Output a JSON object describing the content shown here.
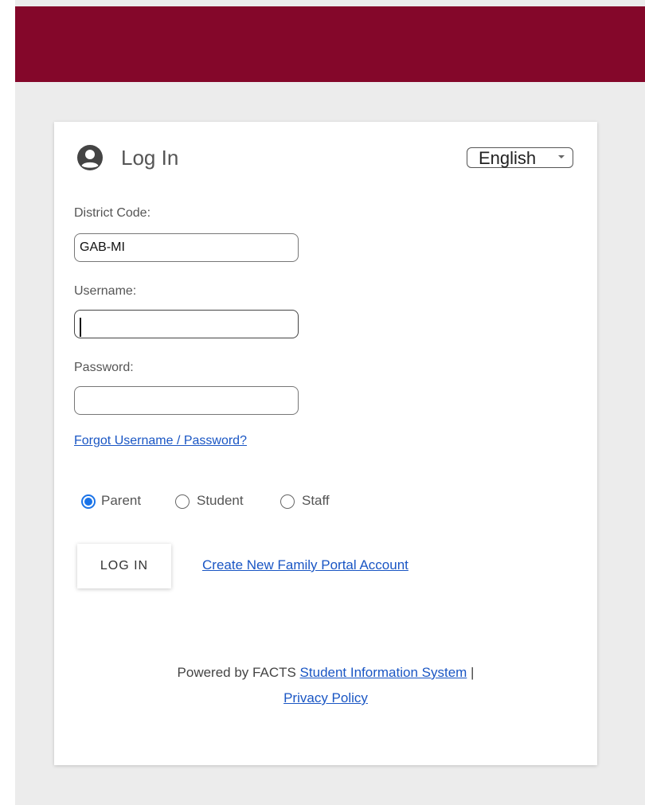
{
  "header": {
    "bar_color": "#84072a"
  },
  "login": {
    "title": "Log In",
    "title_icon": "user-circle-icon",
    "language": {
      "selected": "English",
      "icon": "chevron-down-icon"
    },
    "district_code": {
      "label": "District Code:",
      "value": "GAB-MI"
    },
    "username": {
      "label": "Username:",
      "value": ""
    },
    "password": {
      "label": "Password:",
      "value": ""
    },
    "forgot_link": "Forgot Username / Password?",
    "roles": [
      {
        "label": "Parent",
        "checked": true
      },
      {
        "label": "Student",
        "checked": false
      },
      {
        "label": "Staff",
        "checked": false
      }
    ],
    "login_button": "LOG IN",
    "create_account_link": "Create New Family Portal Account"
  },
  "footer": {
    "powered_by": "Powered by FACTS ",
    "sis_link": "Student Information System",
    "separator": " |",
    "privacy_link": "Privacy Policy"
  },
  "colors": {
    "accent": "#84072a",
    "link": "#1a56c4",
    "radio_selected": "#1a73e8",
    "background": "#ececec"
  }
}
